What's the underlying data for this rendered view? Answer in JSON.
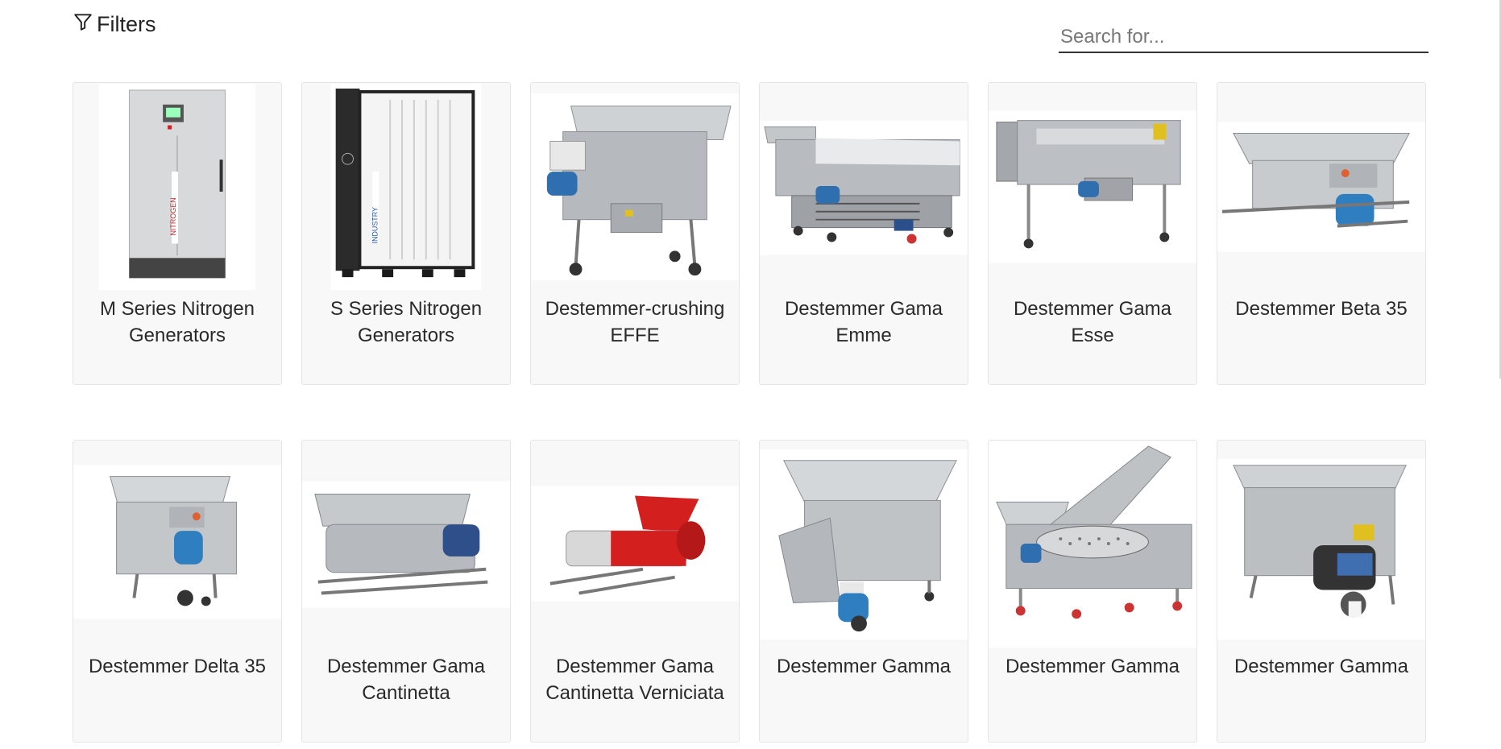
{
  "filters": {
    "label": "Filters",
    "icon": "filter-icon"
  },
  "search": {
    "placeholder": "Search for...",
    "value": ""
  },
  "products": [
    {
      "name": "M Series Nitrogen Generators",
      "image": "nitrogen-generator-cabinet-icon"
    },
    {
      "name": "S Series Nitrogen Generators",
      "image": "nitrogen-generator-rack-icon"
    },
    {
      "name": "Destemmer-crushing EFFE",
      "image": "destemmer-machine-icon"
    },
    {
      "name": "Destemmer Gama Emme",
      "image": "destemmer-machine-icon"
    },
    {
      "name": "Destemmer Gama Esse",
      "image": "destemmer-machine-icon"
    },
    {
      "name": "Destemmer Beta 35",
      "image": "destemmer-machine-icon"
    },
    {
      "name": "Destemmer Delta 35",
      "image": "destemmer-machine-icon"
    },
    {
      "name": "Destemmer Gama Cantinetta",
      "image": "destemmer-machine-icon"
    },
    {
      "name": "Destemmer Gama Cantinetta Verniciata",
      "image": "red-destemmer-machine-icon"
    },
    {
      "name": "Destemmer Gamma",
      "image": "destemmer-machine-icon"
    },
    {
      "name": "Destemmer Gamma",
      "image": "destemmer-drum-machine-icon"
    },
    {
      "name": "Destemmer Gamma",
      "image": "destemmer-machine-icon"
    }
  ],
  "colors": {
    "card_bg": "#f8f8f8",
    "steel": "#b9bcc0",
    "motor_blue": "#2f6fb0",
    "paint_red": "#d41f1f"
  }
}
